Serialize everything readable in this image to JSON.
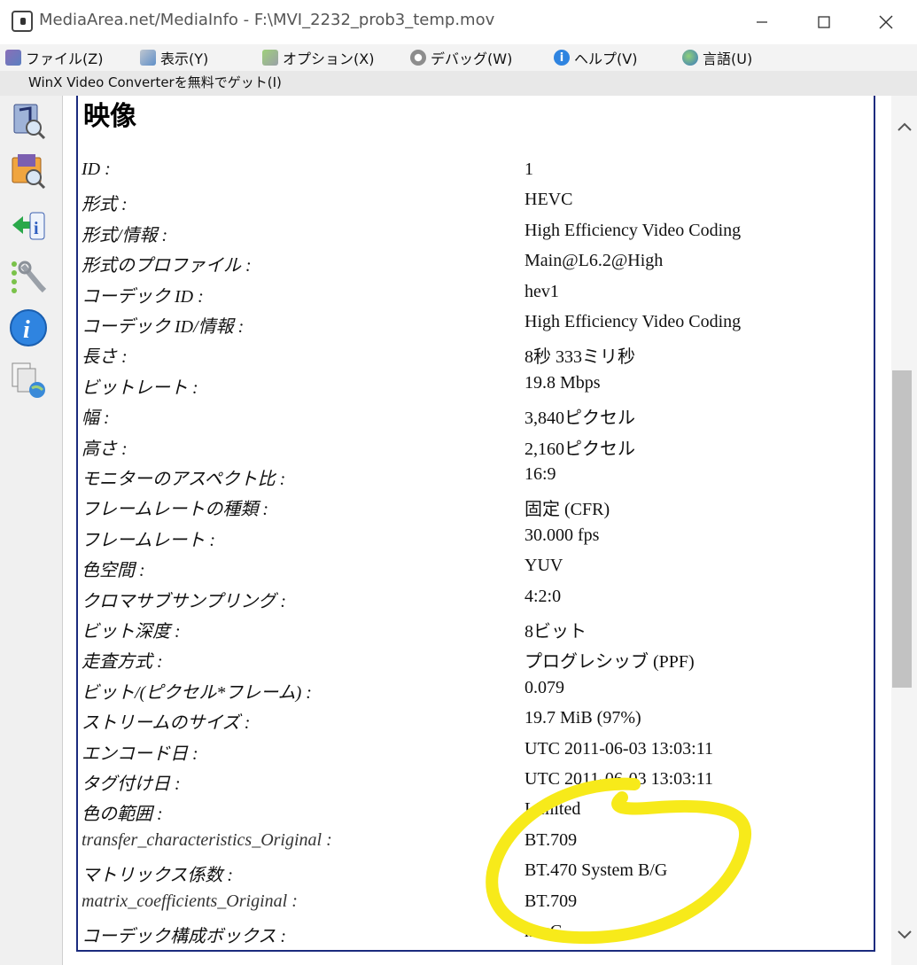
{
  "window": {
    "title": "MediaArea.net/MediaInfo - F:\\MVI_2232_prob3_temp.mov"
  },
  "menu": [
    {
      "label": "ファイル(Z)",
      "icon": "file-icon"
    },
    {
      "label": "表示(Y)",
      "icon": "view-icon"
    },
    {
      "label": "オプション(X)",
      "icon": "options-icon"
    },
    {
      "label": "デバッグ(W)",
      "icon": "debug-icon"
    },
    {
      "label": "ヘルプ(V)",
      "icon": "help-icon"
    },
    {
      "label": "言語(U)",
      "icon": "language-icon"
    }
  ],
  "promo": "WinX Video Converterを無料でゲット(I)",
  "toolbar": [
    {
      "icon": "open-file-icon"
    },
    {
      "icon": "open-folder-icon"
    },
    {
      "icon": "export-icon"
    },
    {
      "icon": "preferences-icon"
    },
    {
      "icon": "info-icon"
    },
    {
      "icon": "website-icon"
    }
  ],
  "section": {
    "heading": "映像",
    "rows": [
      {
        "label": "ID :",
        "value": "1"
      },
      {
        "label": "形式 :",
        "value": "HEVC"
      },
      {
        "label": "形式/情報 :",
        "value": "High Efficiency Video Coding"
      },
      {
        "label": "形式のプロファイル :",
        "value": "Main@L6.2@High"
      },
      {
        "label": "コーデック ID :",
        "value": "hev1"
      },
      {
        "label": "コーデック ID/情報 :",
        "value": "High Efficiency Video Coding"
      },
      {
        "label": "長さ :",
        "value": "8秒 333ミリ秒"
      },
      {
        "label": "ビットレート :",
        "value": "19.8 Mbps"
      },
      {
        "label": "幅 :",
        "value": "3,840ピクセル"
      },
      {
        "label": "高さ :",
        "value": "2,160ピクセル"
      },
      {
        "label": "モニターのアスペクト比 :",
        "value": "16:9"
      },
      {
        "label": "フレームレートの種類 :",
        "value": "固定 (CFR)"
      },
      {
        "label": "フレームレート :",
        "value": "30.000 fps"
      },
      {
        "label": "色空間 :",
        "value": "YUV"
      },
      {
        "label": "クロマサブサンプリング :",
        "value": "4:2:0"
      },
      {
        "label": "ビット深度 :",
        "value": "8ビット"
      },
      {
        "label": "走査方式 :",
        "value": "プログレシッブ (PPF)"
      },
      {
        "label": "ビット/(ピクセル*フレーム) :",
        "value": "0.079"
      },
      {
        "label": "ストリームのサイズ :",
        "value": "19.7 MiB (97%)"
      },
      {
        "label": "エンコード日 :",
        "value": "UTC 2011-06-03 13:03:11"
      },
      {
        "label": "タグ付け日 :",
        "value": "UTC 2011-06-03 13:03:11"
      },
      {
        "label": "色の範囲 :",
        "value": "Limited"
      },
      {
        "label": "transfer_characteristics_Original :",
        "value": "BT.709"
      },
      {
        "label": "マトリックス係数 :",
        "value": "BT.470 System B/G"
      },
      {
        "label": "matrix_coefficients_Original :",
        "value": "BT.709"
      },
      {
        "label": "コーデック構成ボックス :",
        "value": "hvcC"
      }
    ]
  },
  "colors": {
    "annotation": "#f7ea1a",
    "frame": "#1b2b7e"
  }
}
